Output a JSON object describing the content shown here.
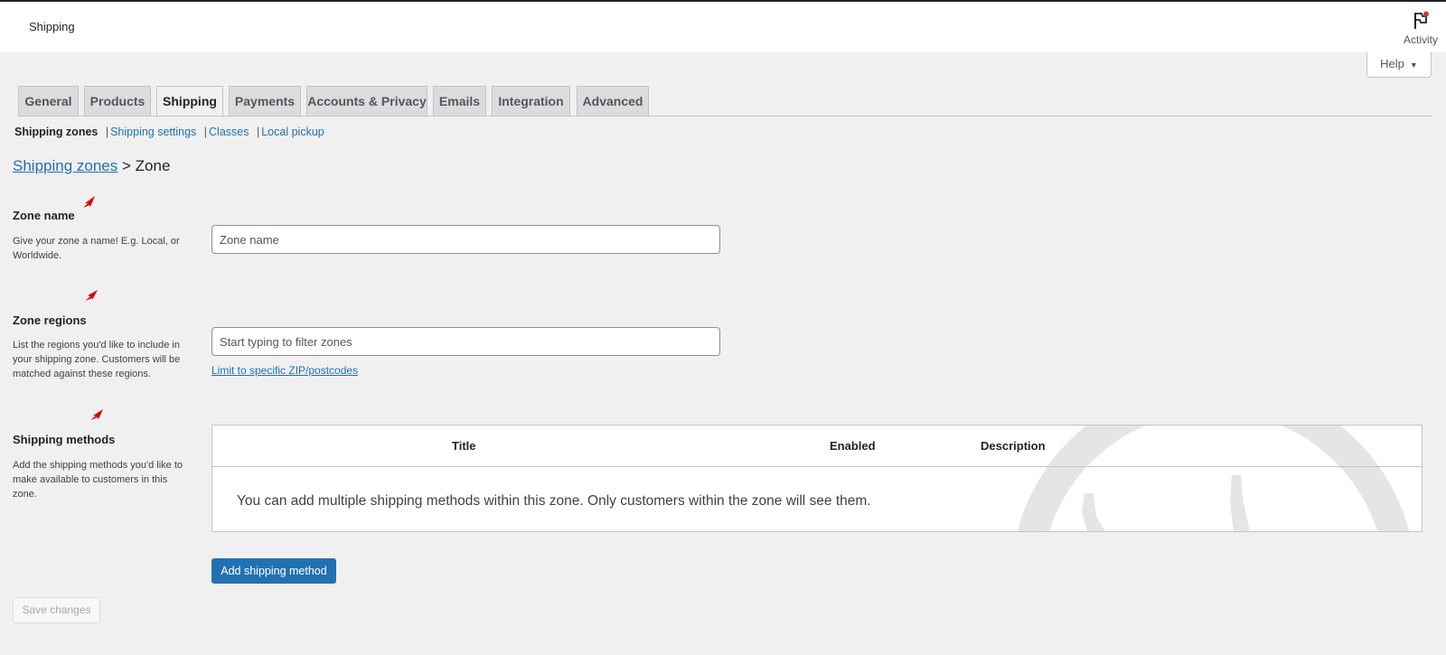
{
  "header": {
    "title": "Shipping",
    "activity_label": "Activity"
  },
  "help": {
    "label": "Help"
  },
  "tabs": [
    {
      "label": "General"
    },
    {
      "label": "Products"
    },
    {
      "label": "Shipping",
      "active": true
    },
    {
      "label": "Payments"
    },
    {
      "label": "Accounts & Privacy"
    },
    {
      "label": "Emails"
    },
    {
      "label": "Integration"
    },
    {
      "label": "Advanced"
    }
  ],
  "subnav": {
    "current": "Shipping zones",
    "links": [
      "Shipping settings",
      "Classes",
      "Local pickup"
    ]
  },
  "breadcrumb": {
    "link": "Shipping zones",
    "separator": ">",
    "current": "Zone"
  },
  "zone_name": {
    "label": "Zone name",
    "description": "Give your zone a name! E.g. Local, or Worldwide.",
    "placeholder": "Zone name",
    "value": ""
  },
  "zone_regions": {
    "label": "Zone regions",
    "description": "List the regions you'd like to include in your shipping zone. Customers will be matched against these regions.",
    "placeholder": "Start typing to filter zones",
    "postcode_link": "Limit to specific ZIP/postcodes"
  },
  "shipping_methods": {
    "label": "Shipping methods",
    "description": "Add the shipping methods you'd like to make available to customers in this zone.",
    "columns": [
      "Title",
      "Enabled",
      "Description"
    ],
    "blank_state": "You can add multiple shipping methods within this zone. Only customers within the zone will see them.",
    "add_button": "Add shipping method"
  },
  "save_button": "Save changes",
  "colors": {
    "primary": "#2271b1",
    "background": "#f0f0f1",
    "annotation_arrow": "#e00000"
  }
}
